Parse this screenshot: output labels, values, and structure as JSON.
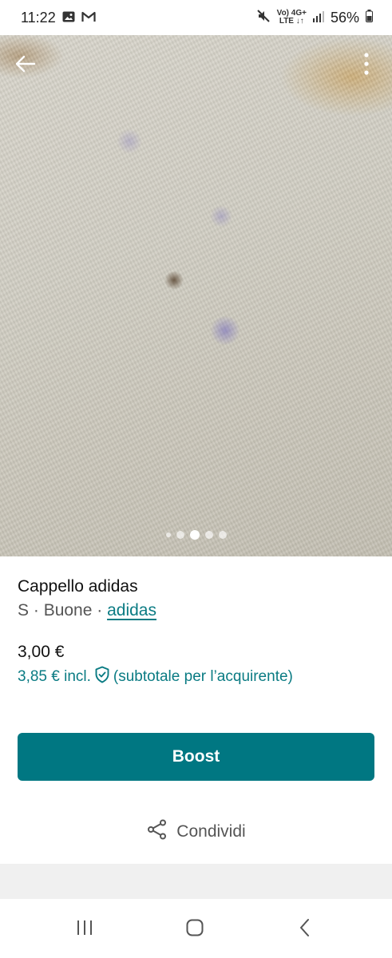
{
  "status_bar": {
    "time": "11:22",
    "battery": "56%",
    "network_top": "Vo) 4G+",
    "network_bottom": "LTE ↓↑"
  },
  "listing": {
    "title": "Cappello adidas",
    "size": "S",
    "condition": "Buone",
    "separator": " · ",
    "brand": "adidas",
    "price": "3,00 €",
    "price_incl": "3,85 € incl.",
    "subtotal_note": "(subtotale per l’acquirente)"
  },
  "photo": {
    "carousel_dot_count": 5,
    "active_dot_index": 2
  },
  "actions": {
    "boost_label": "Boost",
    "share_label": "Condividi"
  },
  "colors": {
    "accent": "#007782",
    "link": "#0a7b83"
  },
  "icons": {
    "back": "arrow-left-icon",
    "more": "more-vertical-icon",
    "share": "share-icon",
    "protection": "shield-check-icon"
  }
}
